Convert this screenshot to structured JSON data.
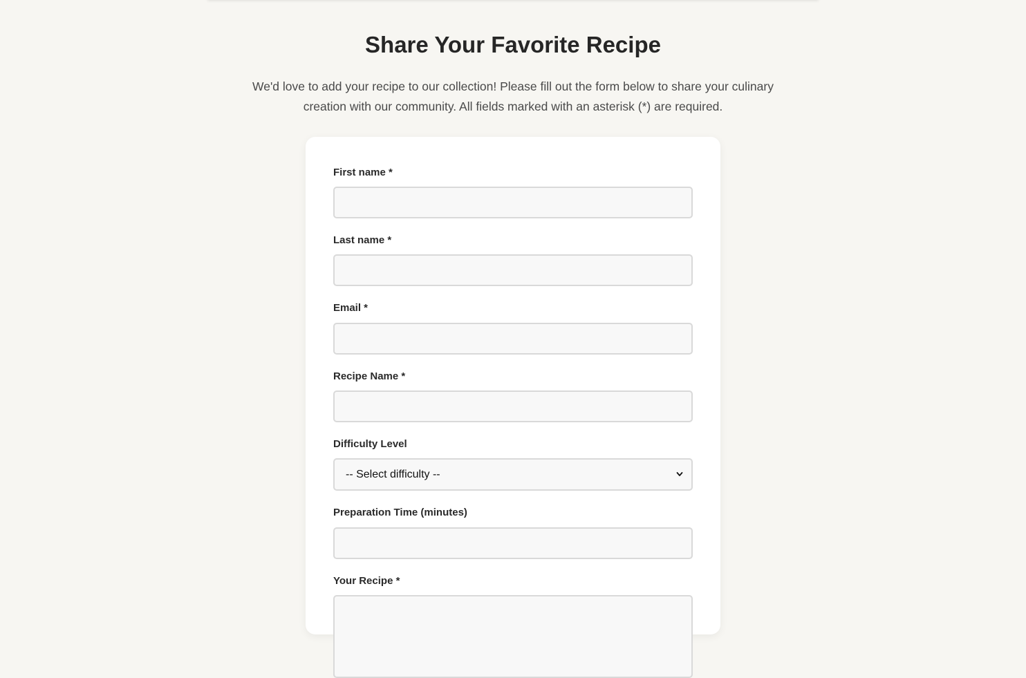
{
  "header": {
    "title": "Share Your Favorite Recipe",
    "intro": "We'd love to add your recipe to our collection! Please fill out the form below to share your culinary creation with our community. All fields marked with an asterisk (*) are required."
  },
  "form": {
    "first_name": {
      "label": "First name *",
      "value": ""
    },
    "last_name": {
      "label": "Last name *",
      "value": ""
    },
    "email": {
      "label": "Email *",
      "value": ""
    },
    "recipe_name": {
      "label": "Recipe Name *",
      "value": ""
    },
    "difficulty": {
      "label": "Difficulty Level",
      "selected": "-- Select difficulty --"
    },
    "prep_time": {
      "label": "Preparation Time (minutes)",
      "value": ""
    },
    "recipe": {
      "label": "Your Recipe *",
      "value": ""
    }
  },
  "icons": {
    "difficulty_dropdown": "chevron-down-icon"
  }
}
